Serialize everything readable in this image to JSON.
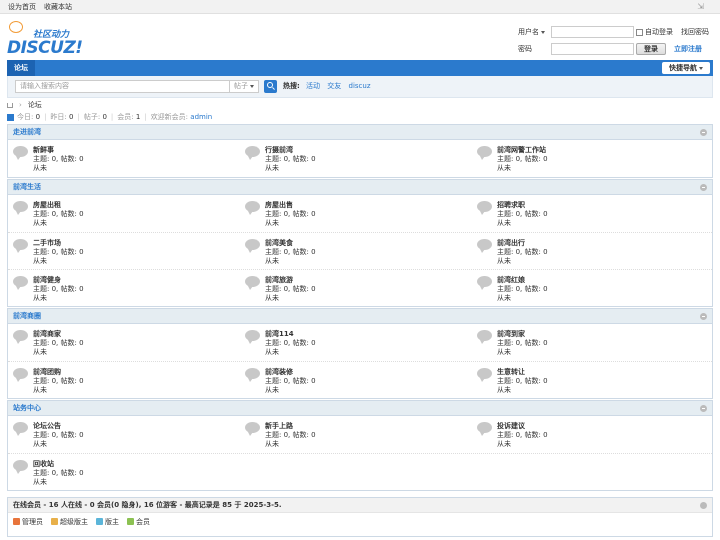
{
  "topbar": {
    "set_home": "设为首页",
    "bookmark": "收藏本站",
    "toggle_icon": "expand-icon"
  },
  "logo": {
    "slogan": "社区动力",
    "word": "DISCUZ!"
  },
  "login": {
    "username_label": "用户名",
    "password_label": "密码",
    "auto_login": "自动登录",
    "forgot": "找回密码",
    "login_button": "登录",
    "register": "立即注册"
  },
  "nav": {
    "forum_tab": "论坛",
    "quick_nav": "快捷导航"
  },
  "search": {
    "placeholder": "请输入搜索内容",
    "type": "帖子",
    "hot_label": "热搜:",
    "hot": [
      "活动",
      "交友",
      "discuz"
    ]
  },
  "breadcrumb": {
    "current": "论坛"
  },
  "stats": {
    "today_label": "今日:",
    "today": "0",
    "yesterday_label": "昨日:",
    "yesterday": "0",
    "posts_label": "帖子:",
    "posts": "0",
    "members_label": "会员:",
    "members": "1",
    "welcome_label": "欢迎新会员:",
    "newest": "admin"
  },
  "groups": [
    {
      "title": "走进前湾",
      "forums": [
        {
          "name": "新鲜事",
          "stat": "主题: 0, 帖数: 0",
          "last": "从未"
        },
        {
          "name": "行摄前湾",
          "stat": "主题: 0, 帖数: 0",
          "last": "从未"
        },
        {
          "name": "前湾网警工作站",
          "stat": "主题: 0, 帖数: 0",
          "last": "从未"
        }
      ]
    },
    {
      "title": "前湾生活",
      "forums": [
        {
          "name": "房屋出租",
          "stat": "主题: 0, 帖数: 0",
          "last": "从未"
        },
        {
          "name": "房屋出售",
          "stat": "主题: 0, 帖数: 0",
          "last": "从未"
        },
        {
          "name": "招聘求职",
          "stat": "主题: 0, 帖数: 0",
          "last": "从未"
        },
        {
          "name": "二手市场",
          "stat": "主题: 0, 帖数: 0",
          "last": "从未"
        },
        {
          "name": "前湾美食",
          "stat": "主题: 0, 帖数: 0",
          "last": "从未"
        },
        {
          "name": "前湾出行",
          "stat": "主题: 0, 帖数: 0",
          "last": "从未"
        },
        {
          "name": "前湾健身",
          "stat": "主题: 0, 帖数: 0",
          "last": "从未"
        },
        {
          "name": "前湾旅游",
          "stat": "主题: 0, 帖数: 0",
          "last": "从未"
        },
        {
          "name": "前湾红娘",
          "stat": "主题: 0, 帖数: 0",
          "last": "从未"
        }
      ]
    },
    {
      "title": "前湾商圈",
      "forums": [
        {
          "name": "前湾商家",
          "stat": "主题: 0, 帖数: 0",
          "last": "从未"
        },
        {
          "name": "前湾114",
          "stat": "主题: 0, 帖数: 0",
          "last": "从未"
        },
        {
          "name": "前湾到家",
          "stat": "主题: 0, 帖数: 0",
          "last": "从未"
        },
        {
          "name": "前湾团购",
          "stat": "主题: 0, 帖数: 0",
          "last": "从未"
        },
        {
          "name": "前湾装修",
          "stat": "主题: 0, 帖数: 0",
          "last": "从未"
        },
        {
          "name": "生意转让",
          "stat": "主题: 0, 帖数: 0",
          "last": "从未"
        }
      ]
    },
    {
      "title": "站务中心",
      "forums": [
        {
          "name": "论坛公告",
          "stat": "主题: 0, 帖数: 0",
          "last": "从未"
        },
        {
          "name": "新手上路",
          "stat": "主题: 0, 帖数: 0",
          "last": "从未"
        },
        {
          "name": "投诉建议",
          "stat": "主题: 0, 帖数: 0",
          "last": "从未"
        },
        {
          "name": "回收站",
          "stat": "主题: 0, 帖数: 0",
          "last": "从未"
        }
      ]
    }
  ],
  "online": {
    "title": "在线会员 - 16 人在线 - 0 会员(0 隐身), 16 位游客 - 最高记录是 85 于 2025-3-5.",
    "legend": [
      {
        "label": "管理员",
        "color": "#e8743b"
      },
      {
        "label": "超级版主",
        "color": "#e8b04a"
      },
      {
        "label": "版主",
        "color": "#5bb5d9"
      },
      {
        "label": "会员",
        "color": "#8cc152"
      }
    ]
  },
  "colors": {
    "accent": "#2b7acd",
    "nav_active": "#1c63b2"
  }
}
